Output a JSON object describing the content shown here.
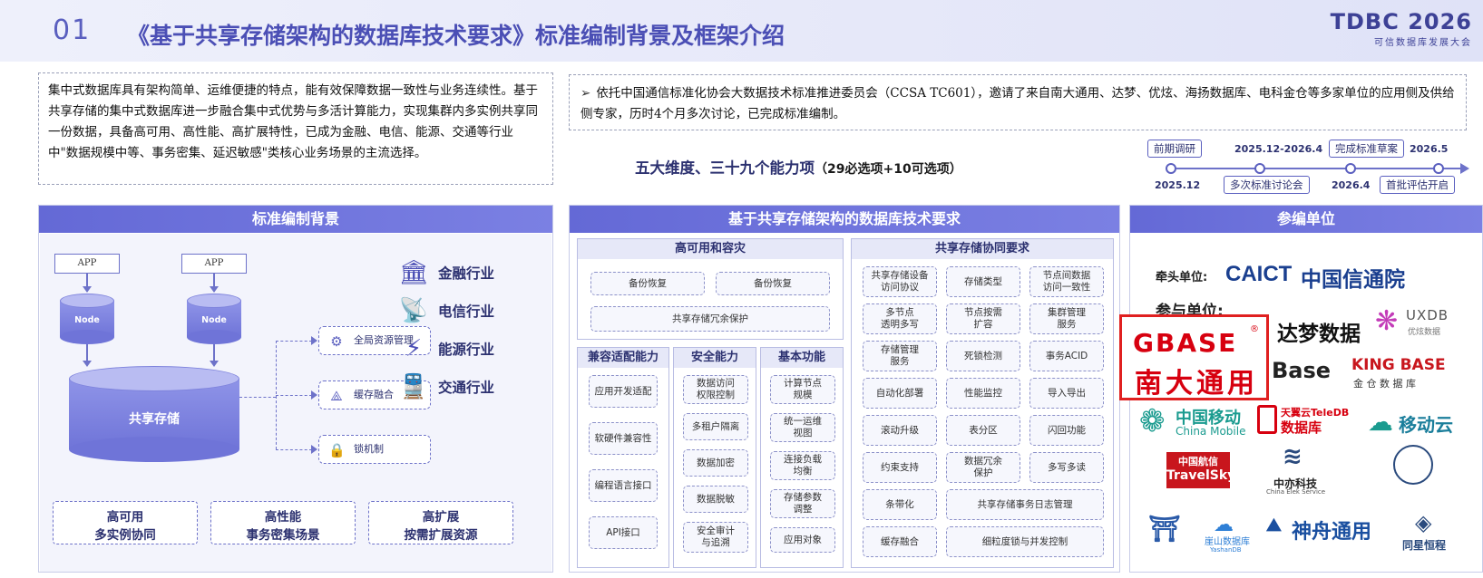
{
  "header": {
    "number": "01",
    "title": "《基于共享存储架构的数据库技术要求》标准编制背景及框架介绍",
    "brand_name": "TDBC 2026",
    "brand_sub": "可信数据库发展大会"
  },
  "intro_left": "集中式数据库具有架构简单、运维便捷的特点，能有效保障数据一致性与业务连续性。基于共享存储的集中式数据库进一步融合集中式优势与多活计算能力，实现集群内多实例共享同一份数据，具备高可用、高性能、高扩展特性，已成为金融、电信、能源、交通等行业中\"数据规模中等、事务密集、延迟敏感\"类核心业务场景的主流选择。",
  "intro_right": {
    "bullet": "➢",
    "text": "依托中国通信标准化协会大数据技术标准推进委员会（CCSA TC601），邀请了来自南大通用、达梦、优炫、海扬数据库、电科金仓等多家单位的应用侧及供给侧专家，历时4个月多次讨论，已完成标准编制。"
  },
  "dimension": {
    "main": "五大维度、三十九个能力项",
    "sub": "（29必选项+10可选项）"
  },
  "timeline": {
    "stages_top": [
      "前期调研",
      "2025.12-2026.4",
      "完成标准草案",
      "2026.5"
    ],
    "stages_bottom": [
      "2025.12",
      "多次标准讨论会",
      "2026.4",
      "首批评估开启"
    ]
  },
  "panel_left": {
    "title": "标准编制背景",
    "app_label": "APP",
    "node_label": "Node",
    "storage_label": "共享存储",
    "features": [
      {
        "icon": "gear-icon",
        "label": "全局资源管理"
      },
      {
        "icon": "network-icon",
        "label": "缓存融合"
      },
      {
        "icon": "lock-icon",
        "label": "锁机制"
      }
    ],
    "industries": [
      {
        "icon": "bank-icon",
        "label": "金融行业"
      },
      {
        "icon": "signal-tower-icon",
        "label": "电信行业"
      },
      {
        "icon": "lightning-icon",
        "label": "能源行业"
      },
      {
        "icon": "train-icon",
        "label": "交通行业"
      }
    ],
    "traits": [
      {
        "title": "高可用",
        "desc": "多实例协同"
      },
      {
        "title": "高性能",
        "desc": "事务密集场景"
      },
      {
        "title": "高扩展",
        "desc": "按需扩展资源"
      }
    ]
  },
  "panel_mid": {
    "title": "基于共享存储架构的数据库技术要求",
    "ha": {
      "title": "高可用和容灾",
      "items": [
        "备份恢复",
        "备份恢复",
        "共享存储冗余保护"
      ]
    },
    "cooperation": {
      "title": "共享存储协同要求",
      "items": [
        "共享存储设备\n访问协议",
        "存储类型",
        "节点间数据\n访问一致性",
        "多节点\n透明多写",
        "节点按需\n扩容",
        "集群管理\n服务",
        "存储管理\n服务",
        "死锁检测",
        "事务ACID",
        "自动化部署",
        "性能监控",
        "导入导出",
        "滚动升级",
        "表分区",
        "闪回功能",
        "约束支持",
        "数据冗余\n保护",
        "多写多读",
        "条带化",
        "共享存储事务日志管理",
        "缓存融合",
        "细粒度锁与并发控制"
      ]
    },
    "compat": {
      "title": "兼容适配能力",
      "items": [
        "应用开发适配",
        "软硬件兼容性",
        "编程语言接口",
        "API接口"
      ]
    },
    "security": {
      "title": "安全能力",
      "items": [
        "数据访问\n权限控制",
        "多租户隔离",
        "数据加密",
        "数据脱敏",
        "安全审计\n与追溯"
      ]
    },
    "basic": {
      "title": "基本功能",
      "items": [
        "计算节点\n规模",
        "统一运维\n视图",
        "连接负载\n均衡",
        "存储参数\n调整",
        "应用对象"
      ]
    }
  },
  "panel_right": {
    "title": "参编单位",
    "lead_label": "牵头单位:",
    "lead_org": {
      "logo": "CAICT",
      "name": "中国信通院"
    },
    "join_label": "参与单位:",
    "logos": {
      "gbase_en": "GBASE",
      "gbase_reg": "®",
      "gbase_cn": "南大通用",
      "dameng": "达梦数据",
      "uxdb_en": "UXDB",
      "uxdb_cn": "优炫数据",
      "base": "Base",
      "kingbase_en": "KING BASE",
      "kingbase_cn": "金 仓 数 据 库",
      "cmcc_cn": "中国移动",
      "cmcc_en": "China Mobile",
      "teledb_top": "天翼云TeleDB",
      "teledb_cn": "数据库",
      "mobilecloud": "移动云",
      "travelsky_cn": "中国航信",
      "travelsky_en": "TravelSky",
      "zhongyan_cn": "中亦科技",
      "zhongyan_en": "China Elek Service",
      "yashan_cn": "崖山数据库",
      "yashan_en": "YashanDB",
      "shenzhou": "神舟通用",
      "tongxing": "同星恒程"
    }
  }
}
